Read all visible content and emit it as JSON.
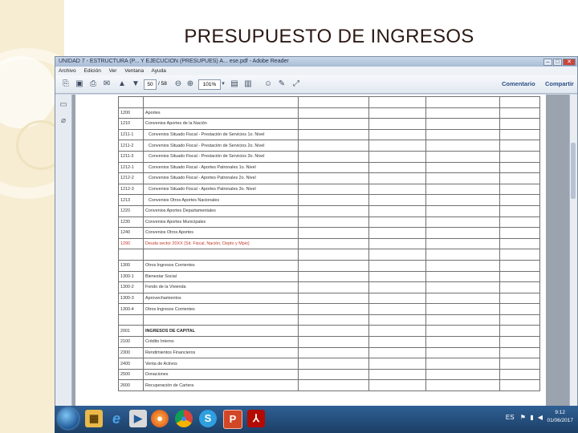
{
  "slide": {
    "title": "PRESUPUESTO DE INGRESOS"
  },
  "window": {
    "title": "UNIDAD 7 - ESTRUCTURA (P... Y EJECUCION (PRESUPUES) A... ese.pdf - Adobe Reader",
    "menu": [
      "Archivo",
      "Edición",
      "Ver",
      "Ventana",
      "Ayuda"
    ],
    "toolbar": {
      "page_current": "50",
      "page_total": "/ 58",
      "zoom": "101%",
      "comment_label": "Comentario",
      "share_label": "Compartir"
    }
  },
  "table": {
    "rows": [
      {
        "code": "",
        "desc": ""
      },
      {
        "code": "1200",
        "desc": "Aportes"
      },
      {
        "code": "1210",
        "desc": "Convenios Aportes de la Nación"
      },
      {
        "code": "1211-1",
        "desc": "Convenios Situado Fiscal - Prestación de Servicios 1o. Nivel"
      },
      {
        "code": "1211-2",
        "desc": "Convenios Situado Fiscal - Prestación de Servicios 2o. Nivel"
      },
      {
        "code": "1211-3",
        "desc": "Convenios Situado Fiscal - Prestación de Servicios 3o. Nivel"
      },
      {
        "code": "1212-1",
        "desc": "Convenios Situado Fiscal - Aportes Patronales 1o. Nivel"
      },
      {
        "code": "1212-2",
        "desc": "Convenios Situado Fiscal - Aportes Patronales 2o. Nivel"
      },
      {
        "code": "1212-3",
        "desc": "Convenios Situado Fiscal - Aportes Patronales 3o. Nivel"
      },
      {
        "code": "1213",
        "desc": "Convenios Otros Aportes Nacionales"
      },
      {
        "code": "1220",
        "desc": "Convenios Aportes Departamentales"
      },
      {
        "code": "1230",
        "desc": "Convenios Aportes Municipales"
      },
      {
        "code": "1240",
        "desc": "Convenios Otros Aportes"
      },
      {
        "code": "1290",
        "desc": "Deuda sector 20XX (Sit. Fiscal, Nación, Depto y Mpio)"
      },
      {
        "code": "",
        "desc": ""
      },
      {
        "code": "1300",
        "desc": "Otros Ingresos Corrientes"
      },
      {
        "code": "1300-1",
        "desc": "Bienestar Social"
      },
      {
        "code": "1300-2",
        "desc": "Fondo de la Vivienda"
      },
      {
        "code": "1300-3",
        "desc": "Aprovechamientos"
      },
      {
        "code": "1300-4",
        "desc": "Otros Ingresos Corrientes"
      },
      {
        "code": "",
        "desc": ""
      },
      {
        "code": "2001",
        "desc": "INGRESOS DE CAPITAL"
      },
      {
        "code": "2100",
        "desc": "Crédito Interno"
      },
      {
        "code": "2300",
        "desc": "Rendimientos Financieros"
      },
      {
        "code": "2400",
        "desc": "Venta de Activos"
      },
      {
        "code": "2500",
        "desc": "Donaciones"
      },
      {
        "code": "2600",
        "desc": "Recuperación de Cartera"
      }
    ]
  },
  "taskbar": {
    "tray_text": "ES",
    "time": "9:12",
    "date": "01/06/2017",
    "apps": [
      "explorer",
      "internet-explorer",
      "media-player",
      "firefox",
      "chrome",
      "skype",
      "powerpoint",
      "adobe-reader"
    ]
  },
  "colors": {
    "deco": "#f6edd3",
    "title": "#2b1a14",
    "taskbar": "#1c3f66",
    "red_text": "#c0392b"
  }
}
